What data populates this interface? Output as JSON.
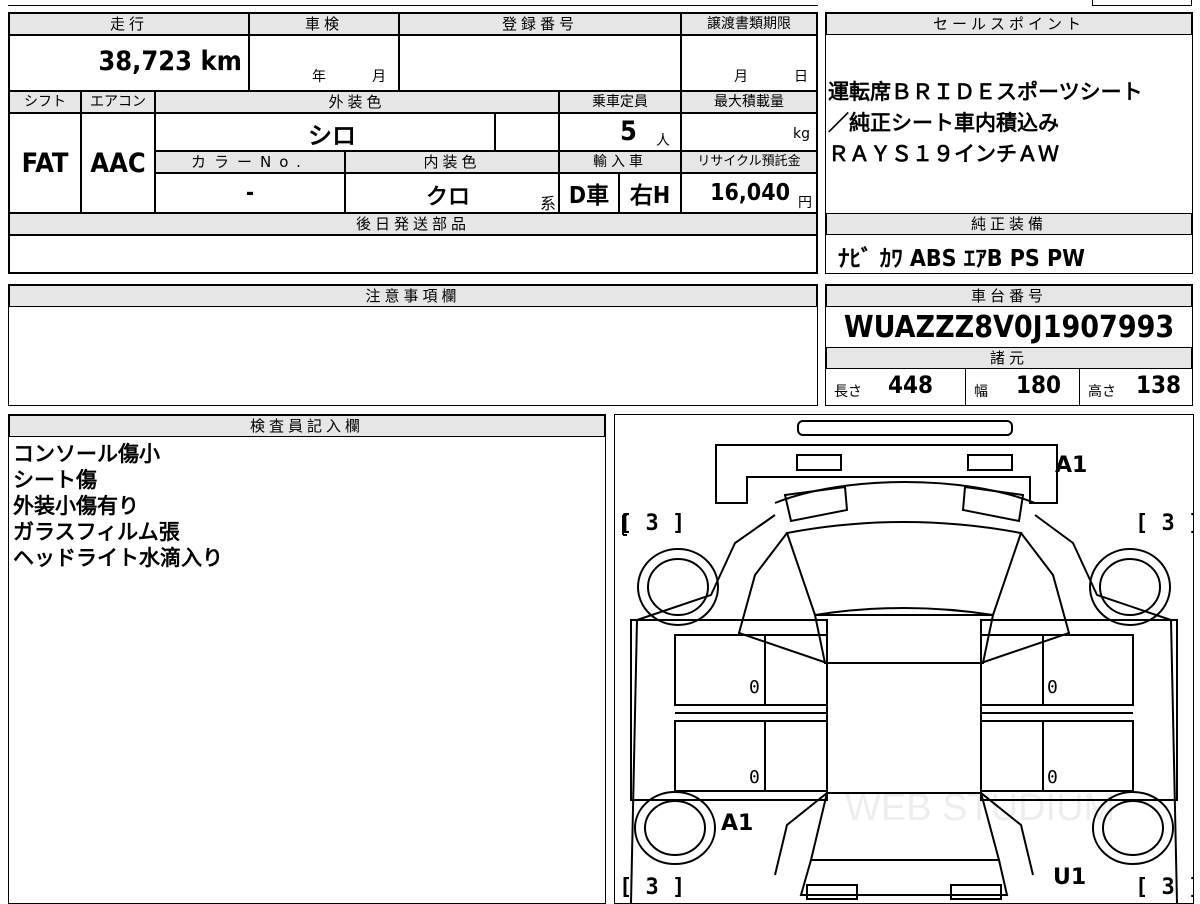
{
  "mileage": {
    "label": "走行",
    "value": "38,723",
    "unit": "km"
  },
  "inspection": {
    "label": "車検",
    "year": "年",
    "month": "月"
  },
  "registration": {
    "label": "登録番号",
    "value": ""
  },
  "transfer_deadline": {
    "label": "譲渡書類期限",
    "month": "月",
    "day": "日"
  },
  "shift": {
    "label": "シフト",
    "value": "FAT"
  },
  "aircon": {
    "label": "エアコン",
    "value": "AAC"
  },
  "exterior_color": {
    "label": "外装色",
    "value": "シロ"
  },
  "capacity": {
    "label": "乗車定員",
    "value": "5",
    "unit": "人"
  },
  "max_load": {
    "label": "最大積載量",
    "value": "",
    "unit": "kg"
  },
  "color_no": {
    "label": "カラーNo.",
    "value": "-"
  },
  "interior_color": {
    "label": "内装色",
    "value": "クロ",
    "suffix": "系"
  },
  "import": {
    "label": "輸入車",
    "type": "D車",
    "handle": "右H"
  },
  "recycle": {
    "label": "リサイクル預託金",
    "value": "16,040",
    "unit": "円"
  },
  "later_parts": {
    "label": "後日発送部品",
    "value": ""
  },
  "notes": {
    "label": "注意事項欄",
    "value": ""
  },
  "sales_points": {
    "label": "セールスポイント",
    "lines": [
      "運転席ＢＲＩＤＥスポーツシート",
      "／純正シート車内積込み",
      "ＲＡＹＳ１９インチＡＷ"
    ]
  },
  "equipment": {
    "label": "純正装備",
    "value": "ﾅﾋﾞ ｶﾜ ABS ｴｱB PS PW"
  },
  "chassis": {
    "label": "車台番号",
    "value": "WUAZZZ8V0J1907993"
  },
  "specs": {
    "label": "諸元",
    "length_label": "長さ",
    "length": "448",
    "width_label": "幅",
    "width": "180",
    "height_label": "高さ",
    "height": "138"
  },
  "inspector": {
    "label": "検査員記入欄",
    "lines": [
      "コンソール傷小",
      "シート傷",
      "外装小傷有り",
      "ガラスフィルム張",
      "ヘッドライト水滴入り"
    ]
  },
  "diagram": {
    "grade_fl": "[ 3 ]",
    "grade_fr": "[ 3 ]",
    "grade_rl": "[ 3 ]",
    "grade_rr": "[ 3 ]",
    "mark_front": "A1",
    "mark_rear_left": "A1",
    "mark_rear_right": "U1",
    "door_fl": "0",
    "door_rl": "0",
    "door_fr": "0",
    "door_rr": "0",
    "watermark": "WEB STUDIUM"
  }
}
